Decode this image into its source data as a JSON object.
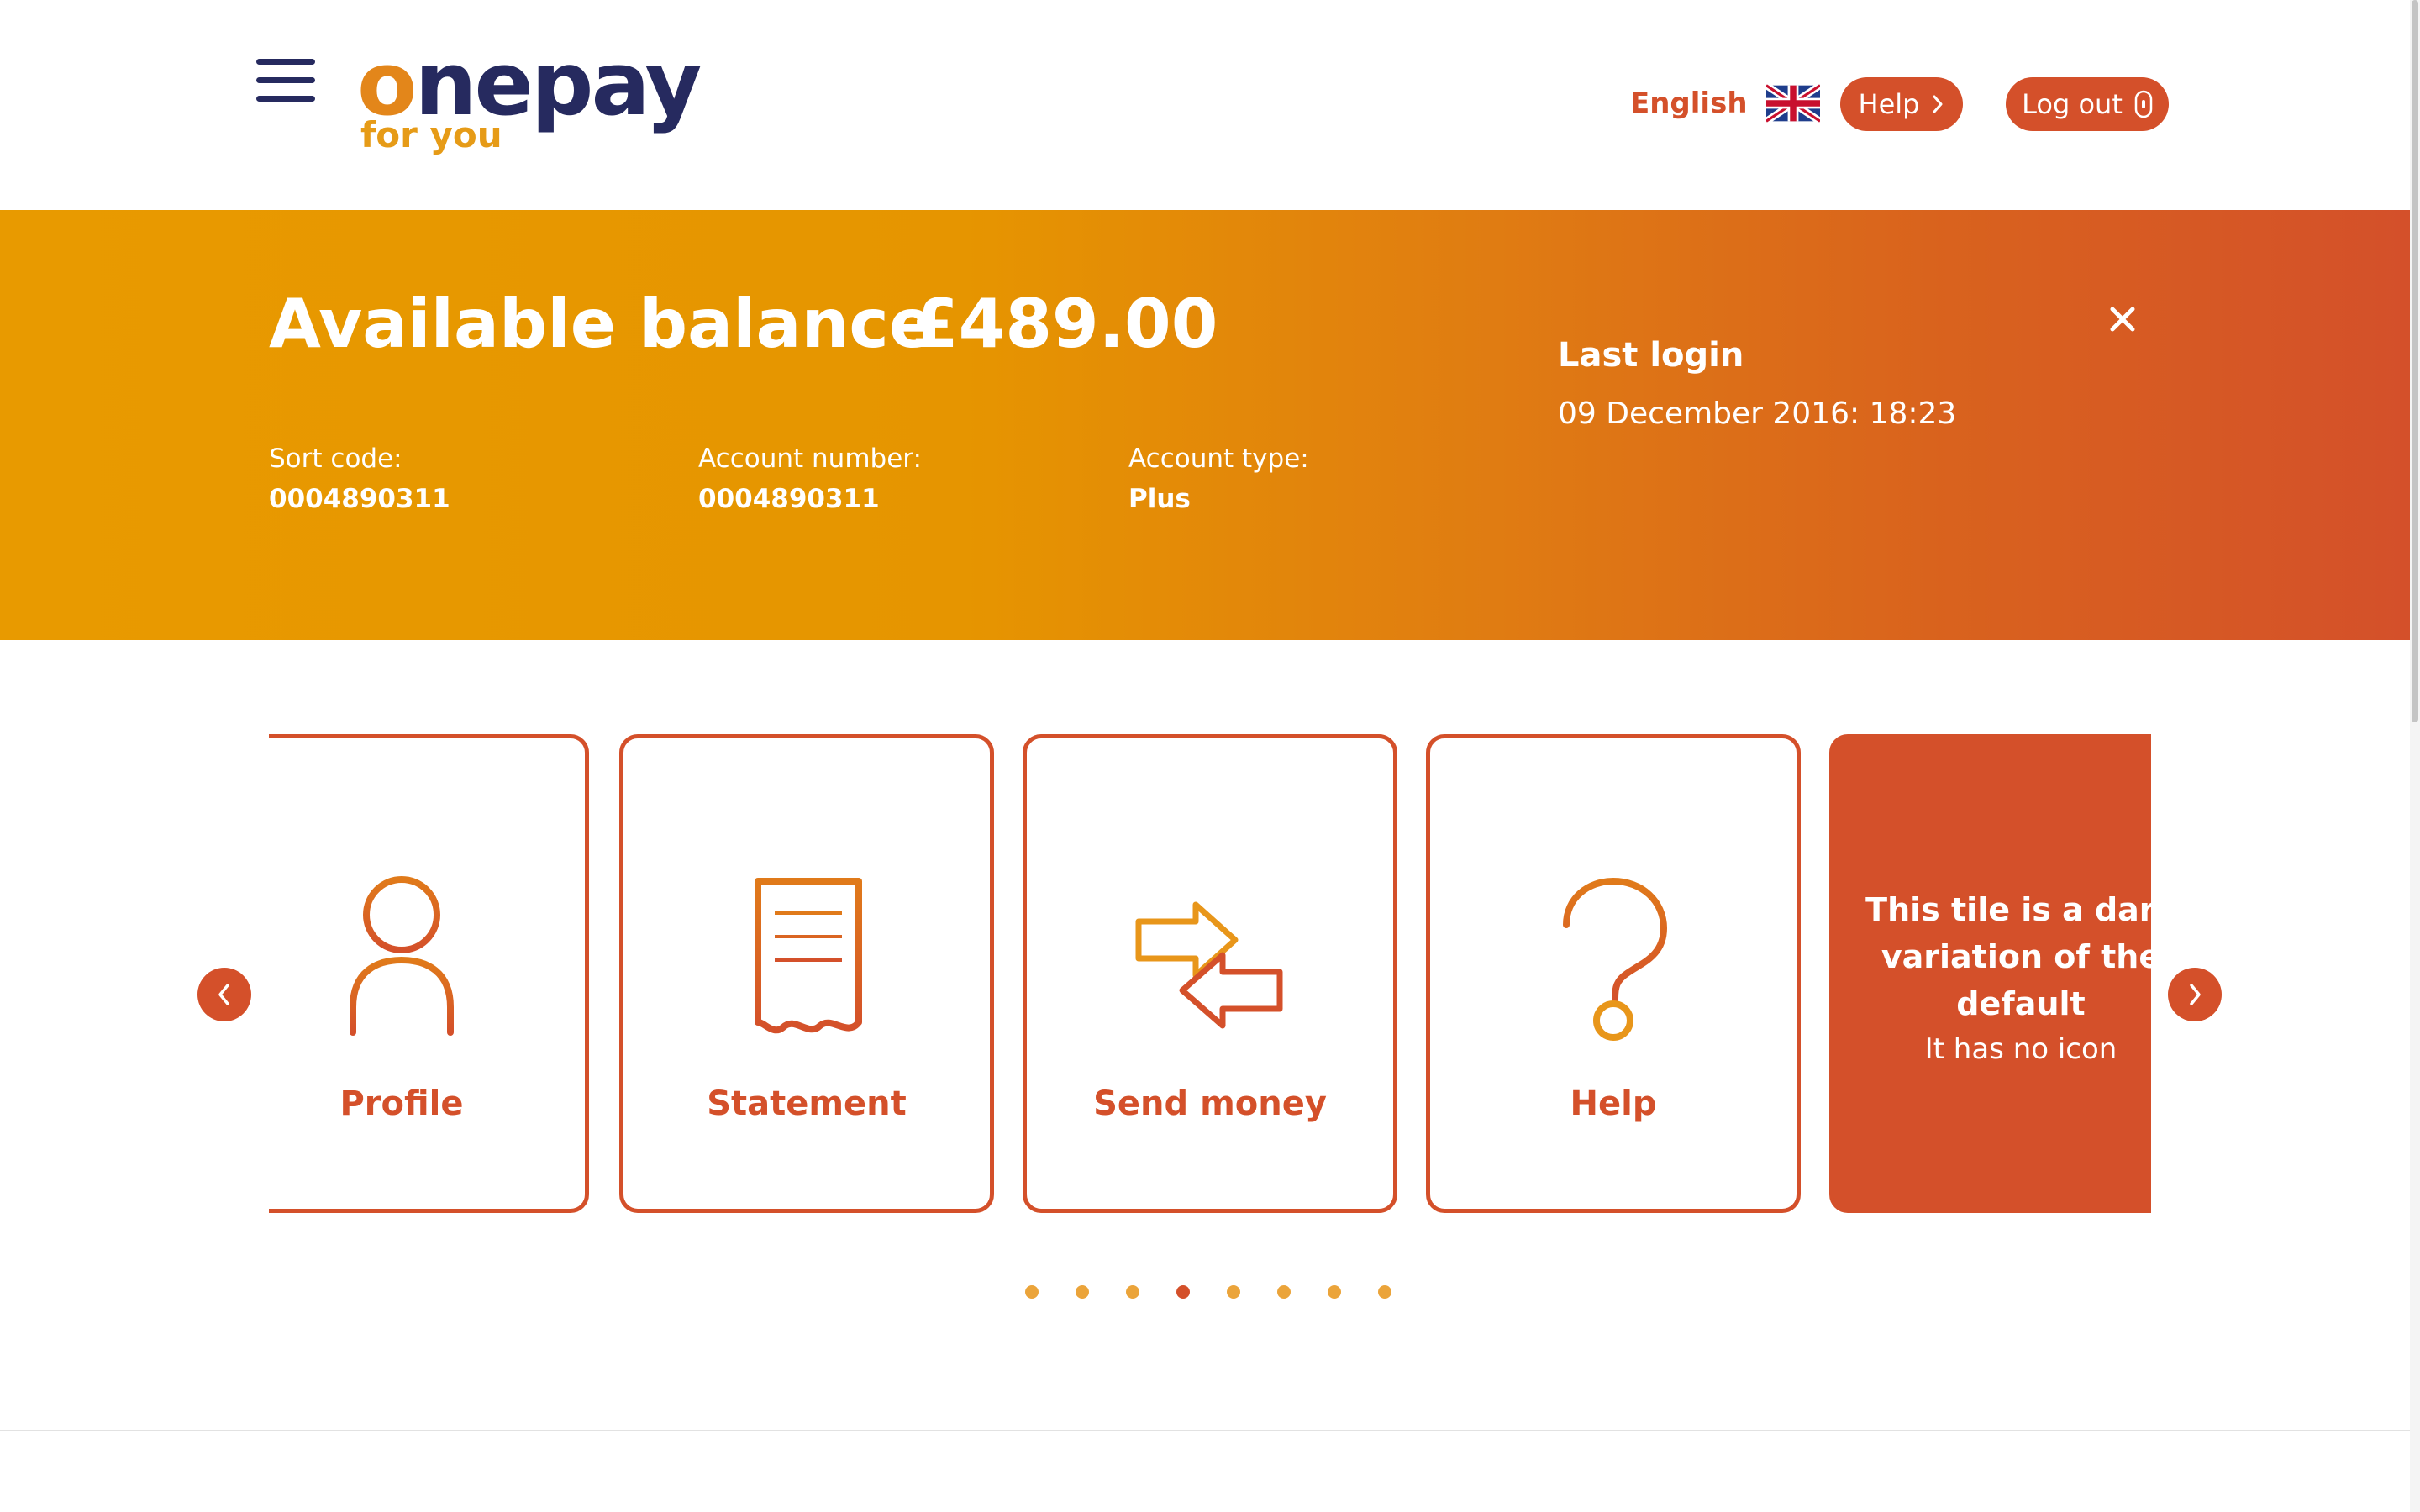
{
  "header": {
    "menu_icon": "hamburger-menu-icon",
    "logo": {
      "brand": "onepay",
      "tagline": "for you"
    },
    "language": {
      "label": "English",
      "flag_icon": "uk-flag-icon"
    },
    "help_button": {
      "label": "Help",
      "icon": "chevron-right-icon"
    },
    "logout_button": {
      "label": "Log out",
      "icon": "lock-icon"
    }
  },
  "balance_banner": {
    "balance_label": "Available balance",
    "balance_value": "£489.00",
    "sort_code": {
      "label": "Sort code:",
      "value": "0004890311"
    },
    "account_number": {
      "label": "Account number:",
      "value": "0004890311"
    },
    "account_type": {
      "label": "Account type:",
      "value": "Plus"
    },
    "last_login": {
      "label": "Last login",
      "value": "09 December 2016: 18:23"
    },
    "close_icon": "close-icon"
  },
  "carousel": {
    "tiles": [
      {
        "label": "Profile",
        "icon": "user-icon"
      },
      {
        "label": "Statement",
        "icon": "receipt-icon"
      },
      {
        "label": "Send money",
        "icon": "transfer-arrows-icon"
      },
      {
        "label": "Help",
        "icon": "question-mark-icon"
      },
      {
        "title": "This tile is a dark variation of the default",
        "subtitle": "It has no icon"
      }
    ],
    "prev_icon": "chevron-left-icon",
    "next_icon": "chevron-right-icon",
    "dots_total": 8,
    "active_dot_index": 3
  },
  "colors": {
    "accent": "#d4502a",
    "brand_navy": "#262a5f",
    "brand_orange": "#e69b17",
    "banner_start": "#e89a00",
    "banner_end": "#d4502a",
    "dot_inactive": "#eba43a"
  }
}
